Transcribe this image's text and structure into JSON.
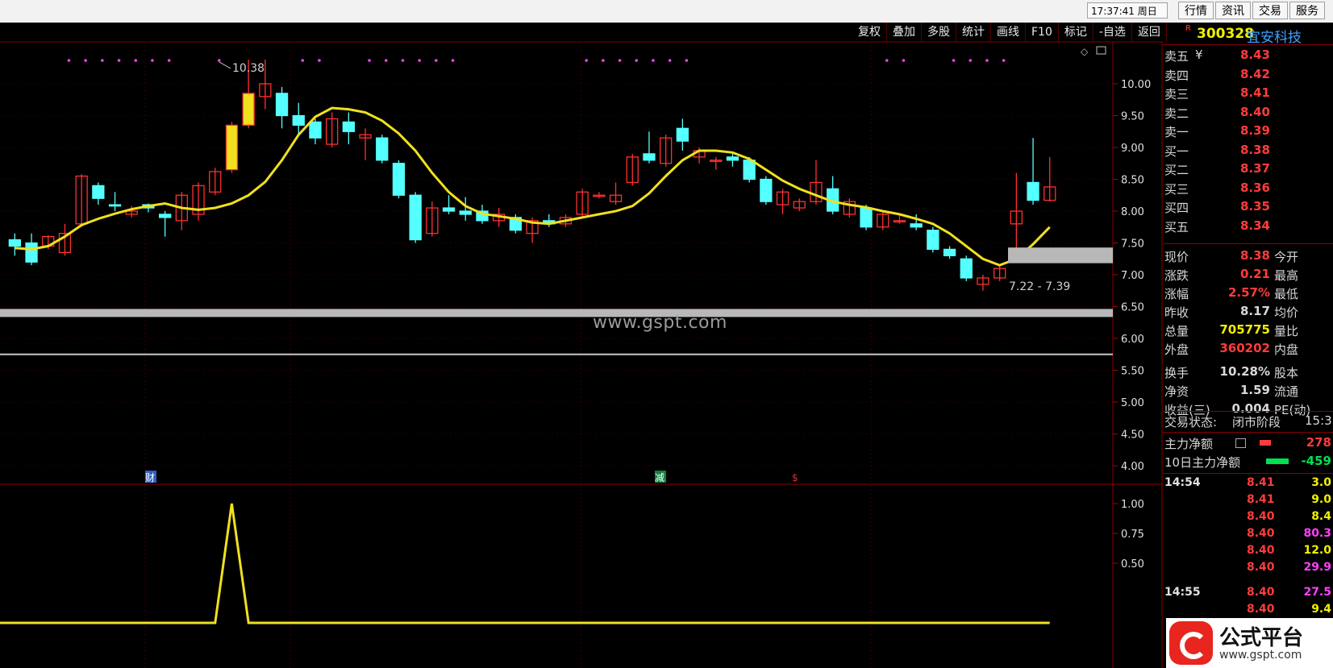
{
  "topbar": {
    "clock": "17:37:41 周日",
    "buttons": [
      "行情",
      "资讯",
      "交易",
      "服务"
    ]
  },
  "toolbar": [
    "复权",
    "叠加",
    "多股",
    "统计",
    "画线",
    "F10",
    "标记",
    "-自选",
    "返回"
  ],
  "stock": {
    "badge": "R",
    "code": "300328",
    "name": "宜安科技"
  },
  "order_book": {
    "asks": [
      {
        "label": "卖五",
        "price": "8.43"
      },
      {
        "label": "卖四",
        "price": "8.42"
      },
      {
        "label": "卖三",
        "price": "8.41"
      },
      {
        "label": "卖二",
        "price": "8.40"
      },
      {
        "label": "卖一",
        "price": "8.39"
      }
    ],
    "bids": [
      {
        "label": "买一",
        "price": "8.38"
      },
      {
        "label": "买二",
        "price": "8.37"
      },
      {
        "label": "买三",
        "price": "8.36"
      },
      {
        "label": "买四",
        "price": "8.35"
      },
      {
        "label": "买五",
        "price": "8.34"
      }
    ],
    "currency_mark": "¥"
  },
  "quote": [
    {
      "label": "现价",
      "value": "8.38",
      "label2": "今开"
    },
    {
      "label": "涨跌",
      "value": "0.21",
      "label2": "最高"
    },
    {
      "label": "涨幅",
      "value": "2.57%",
      "label2": "最低"
    },
    {
      "label": "昨收",
      "value": "8.17",
      "label2": "均价"
    },
    {
      "label": "总量",
      "value": "705775",
      "label2": "量比"
    },
    {
      "label": "外盘",
      "value": "360202",
      "label2": "内盘"
    },
    {
      "label": "换手",
      "value": "10.28%",
      "label2": "股本"
    },
    {
      "label": "净资",
      "value": "1.59",
      "label2": "流通"
    },
    {
      "label": "收益(三)",
      "value": "0.004",
      "label2": "PE(动)"
    }
  ],
  "status": {
    "label": "交易状态:",
    "value": "闭市阶段",
    "time": "15:3"
  },
  "main_force": [
    {
      "label": "主力净额",
      "value": "278"
    },
    {
      "label": "10日主力净额",
      "value": "-459"
    }
  ],
  "ticks": [
    {
      "time": "14:54",
      "price": "8.41",
      "vol": "3.0",
      "color": "#f0f000"
    },
    {
      "time": "",
      "price": "8.41",
      "vol": "9.0",
      "color": "#f0f000"
    },
    {
      "time": "",
      "price": "8.40",
      "vol": "8.4",
      "color": "#f0f000"
    },
    {
      "time": "",
      "price": "8.40",
      "vol": "80.3",
      "color": "#ff40ff"
    },
    {
      "time": "",
      "price": "8.40",
      "vol": "12.0",
      "color": "#f0f000"
    },
    {
      "time": "",
      "price": "8.40",
      "vol": "29.9",
      "color": "#ff40ff"
    },
    {
      "time": "14:55",
      "price": "8.40",
      "vol": "27.5",
      "color": "#ff40ff"
    },
    {
      "time": "",
      "price": "8.40",
      "vol": "9.4",
      "color": "#f0f000"
    }
  ],
  "logo": {
    "name": "公式平台",
    "url": "www.gspt.com"
  },
  "watermark": "www.gspt.com",
  "chart_data": [
    {
      "type": "candlestick",
      "title": "",
      "ylim": [
        4.0,
        10.0
      ],
      "yticks": [
        "10.00",
        "9.50",
        "9.00",
        "8.50",
        "8.00",
        "7.50",
        "7.00",
        "6.50",
        "6.00",
        "5.50",
        "5.00",
        "4.50",
        "4.00"
      ],
      "high_label": "10.38",
      "range_label": "7.22 - 7.39",
      "range": [
        7.22,
        7.39
      ],
      "support_line": 6.4,
      "resistance_line": 5.75,
      "event_markers": [
        "财",
        "减",
        "$"
      ],
      "ma_color": "#f0e020",
      "candles": [
        {
          "o": 7.55,
          "c": 7.45,
          "h": 7.65,
          "l": 7.3
        },
        {
          "o": 7.5,
          "c": 7.2,
          "h": 7.65,
          "l": 7.15
        },
        {
          "o": 7.45,
          "c": 7.6,
          "h": 7.62,
          "l": 7.4
        },
        {
          "o": 7.35,
          "c": 7.65,
          "h": 7.8,
          "l": 7.3
        },
        {
          "o": 7.8,
          "c": 8.55,
          "h": 8.58,
          "l": 7.75
        },
        {
          "o": 8.4,
          "c": 8.2,
          "h": 8.45,
          "l": 8.1
        },
        {
          "o": 8.1,
          "c": 8.08,
          "h": 8.3,
          "l": 8.0
        },
        {
          "o": 7.95,
          "c": 8.0,
          "h": 8.08,
          "l": 7.9
        },
        {
          "o": 8.1,
          "c": 8.05,
          "h": 8.12,
          "l": 7.98
        },
        {
          "o": 7.95,
          "c": 7.9,
          "h": 8.0,
          "l": 7.6
        },
        {
          "o": 7.85,
          "c": 8.25,
          "h": 8.3,
          "l": 7.7
        },
        {
          "o": 7.95,
          "c": 8.4,
          "h": 8.45,
          "l": 7.85
        },
        {
          "o": 8.3,
          "c": 8.62,
          "h": 8.68,
          "l": 8.25
        },
        {
          "o": 8.65,
          "c": 9.35,
          "h": 9.4,
          "l": 8.6
        },
        {
          "o": 9.35,
          "c": 9.85,
          "h": 10.38,
          "l": 9.3
        },
        {
          "o": 9.8,
          "c": 10.0,
          "h": 10.38,
          "l": 9.6
        },
        {
          "o": 9.85,
          "c": 9.5,
          "h": 9.95,
          "l": 9.3
        },
        {
          "o": 9.5,
          "c": 9.35,
          "h": 9.7,
          "l": 9.2
        },
        {
          "o": 9.4,
          "c": 9.15,
          "h": 9.45,
          "l": 9.05
        },
        {
          "o": 9.05,
          "c": 9.45,
          "h": 9.55,
          "l": 9.0
        },
        {
          "o": 9.4,
          "c": 9.25,
          "h": 9.55,
          "l": 9.05
        },
        {
          "o": 9.15,
          "c": 9.2,
          "h": 9.3,
          "l": 8.8
        },
        {
          "o": 9.15,
          "c": 8.8,
          "h": 9.2,
          "l": 8.75
        },
        {
          "o": 8.75,
          "c": 8.25,
          "h": 8.8,
          "l": 8.2
        },
        {
          "o": 8.25,
          "c": 7.55,
          "h": 8.3,
          "l": 7.5
        },
        {
          "o": 7.65,
          "c": 8.05,
          "h": 8.15,
          "l": 7.6
        },
        {
          "o": 8.05,
          "c": 8.0,
          "h": 8.25,
          "l": 7.95
        },
        {
          "o": 8.0,
          "c": 7.95,
          "h": 8.22,
          "l": 7.85
        },
        {
          "o": 8.0,
          "c": 7.85,
          "h": 8.1,
          "l": 7.8
        },
        {
          "o": 7.85,
          "c": 7.95,
          "h": 8.05,
          "l": 7.75
        },
        {
          "o": 7.9,
          "c": 7.7,
          "h": 7.95,
          "l": 7.65
        },
        {
          "o": 7.65,
          "c": 7.85,
          "h": 7.9,
          "l": 7.5
        },
        {
          "o": 7.85,
          "c": 7.8,
          "h": 7.95,
          "l": 7.75
        },
        {
          "o": 7.8,
          "c": 7.9,
          "h": 7.95,
          "l": 7.75
        },
        {
          "o": 7.95,
          "c": 8.3,
          "h": 8.35,
          "l": 7.9
        },
        {
          "o": 8.25,
          "c": 8.25,
          "h": 8.3,
          "l": 8.2
        },
        {
          "o": 8.15,
          "c": 8.25,
          "h": 8.45,
          "l": 8.1
        },
        {
          "o": 8.45,
          "c": 8.85,
          "h": 8.9,
          "l": 8.4
        },
        {
          "o": 8.9,
          "c": 8.8,
          "h": 9.25,
          "l": 8.75
        },
        {
          "o": 8.75,
          "c": 9.15,
          "h": 9.2,
          "l": 8.7
        },
        {
          "o": 9.3,
          "c": 9.1,
          "h": 9.45,
          "l": 8.95
        },
        {
          "o": 8.85,
          "c": 8.95,
          "h": 9.0,
          "l": 8.75
        },
        {
          "o": 8.8,
          "c": 8.8,
          "h": 8.85,
          "l": 8.65
        },
        {
          "o": 8.85,
          "c": 8.8,
          "h": 8.9,
          "l": 8.7
        },
        {
          "o": 8.8,
          "c": 8.5,
          "h": 8.85,
          "l": 8.45
        },
        {
          "o": 8.5,
          "c": 8.15,
          "h": 8.55,
          "l": 8.1
        },
        {
          "o": 8.1,
          "c": 8.3,
          "h": 8.35,
          "l": 7.95
        },
        {
          "o": 8.05,
          "c": 8.15,
          "h": 8.2,
          "l": 8.0
        },
        {
          "o": 8.15,
          "c": 8.45,
          "h": 8.8,
          "l": 8.1
        },
        {
          "o": 8.35,
          "c": 8.0,
          "h": 8.55,
          "l": 7.95
        },
        {
          "o": 7.95,
          "c": 8.15,
          "h": 8.2,
          "l": 7.9
        },
        {
          "o": 8.05,
          "c": 7.75,
          "h": 8.1,
          "l": 7.7
        },
        {
          "o": 7.75,
          "c": 7.95,
          "h": 8.0,
          "l": 7.7
        },
        {
          "o": 7.85,
          "c": 7.85,
          "h": 7.95,
          "l": 7.8
        },
        {
          "o": 7.8,
          "c": 7.75,
          "h": 7.95,
          "l": 7.7
        },
        {
          "o": 7.7,
          "c": 7.4,
          "h": 7.75,
          "l": 7.35
        },
        {
          "o": 7.4,
          "c": 7.3,
          "h": 7.45,
          "l": 7.25
        },
        {
          "o": 7.25,
          "c": 6.95,
          "h": 7.3,
          "l": 6.9
        },
        {
          "o": 6.85,
          "c": 6.95,
          "h": 7.0,
          "l": 6.75
        },
        {
          "o": 6.95,
          "c": 7.1,
          "h": 7.15,
          "l": 6.9
        },
        {
          "o": 7.8,
          "c": 8.0,
          "h": 8.6,
          "l": 7.35
        },
        {
          "o": 8.45,
          "c": 8.17,
          "h": 9.15,
          "l": 8.1
        },
        {
          "o": 8.17,
          "c": 8.38,
          "h": 8.85,
          "l": 8.15
        }
      ],
      "ma": [
        7.42,
        7.4,
        7.45,
        7.6,
        7.78,
        7.88,
        7.96,
        8.03,
        8.08,
        8.12,
        8.05,
        8.02,
        8.05,
        8.12,
        8.25,
        8.46,
        8.8,
        9.2,
        9.48,
        9.62,
        9.6,
        9.55,
        9.42,
        9.22,
        8.95,
        8.6,
        8.3,
        8.08,
        7.96,
        7.92,
        7.88,
        7.82,
        7.8,
        7.85,
        7.9,
        7.95,
        8.0,
        8.08,
        8.28,
        8.55,
        8.8,
        8.95,
        8.95,
        8.92,
        8.82,
        8.65,
        8.48,
        8.35,
        8.25,
        8.15,
        8.1,
        8.06,
        8.0,
        7.95,
        7.88,
        7.8,
        7.65,
        7.45,
        7.25,
        7.15,
        7.25,
        7.48,
        7.75
      ]
    },
    {
      "type": "line",
      "title": "",
      "ylim": [
        0,
        1
      ],
      "yticks": [
        "1.00",
        "0.75",
        "0.50"
      ],
      "series": [
        {
          "values": [
            0,
            0,
            0,
            0,
            0,
            0,
            0,
            0,
            0,
            0,
            0,
            0,
            0,
            1,
            0,
            0,
            0,
            0,
            0,
            0,
            0,
            0,
            0,
            0,
            0,
            0,
            0,
            0,
            0,
            0,
            0,
            0,
            0,
            0,
            0,
            0,
            0,
            0,
            0,
            0,
            0,
            0,
            0,
            0,
            0,
            0,
            0,
            0,
            0,
            0,
            0,
            0,
            0,
            0,
            0,
            0,
            0,
            0,
            0,
            0,
            0,
            0,
            0
          ]
        }
      ],
      "color": "#f0e020"
    }
  ]
}
